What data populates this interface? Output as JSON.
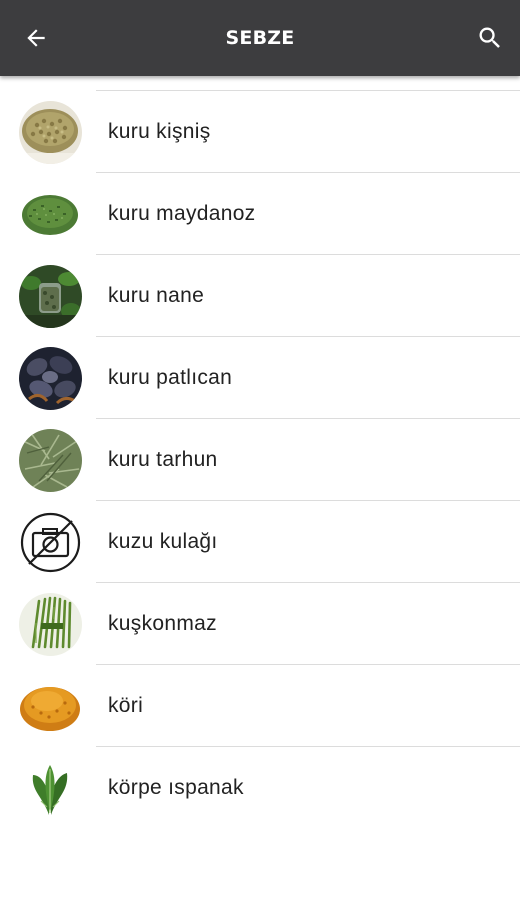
{
  "appbar": {
    "title": "SEBZE",
    "back_icon": "arrow-back-icon",
    "search_icon": "search-icon",
    "background": "#3d3d3f"
  },
  "items": [
    {
      "label": "kuru kişniş",
      "image": "coriander-seeds-image"
    },
    {
      "label": "kuru maydanoz",
      "image": "dried-parsley-image"
    },
    {
      "label": "kuru nane",
      "image": "dried-mint-image"
    },
    {
      "label": "kuru patlıcan",
      "image": "dried-eggplant-image"
    },
    {
      "label": "kuru tarhun",
      "image": "dried-tarragon-image"
    },
    {
      "label": "kuzu kulağı",
      "image": "no-photo-icon"
    },
    {
      "label": "kuşkonmaz",
      "image": "asparagus-image"
    },
    {
      "label": "köri",
      "image": "curry-powder-image"
    },
    {
      "label": "körpe ıspanak",
      "image": "spinach-image"
    }
  ]
}
